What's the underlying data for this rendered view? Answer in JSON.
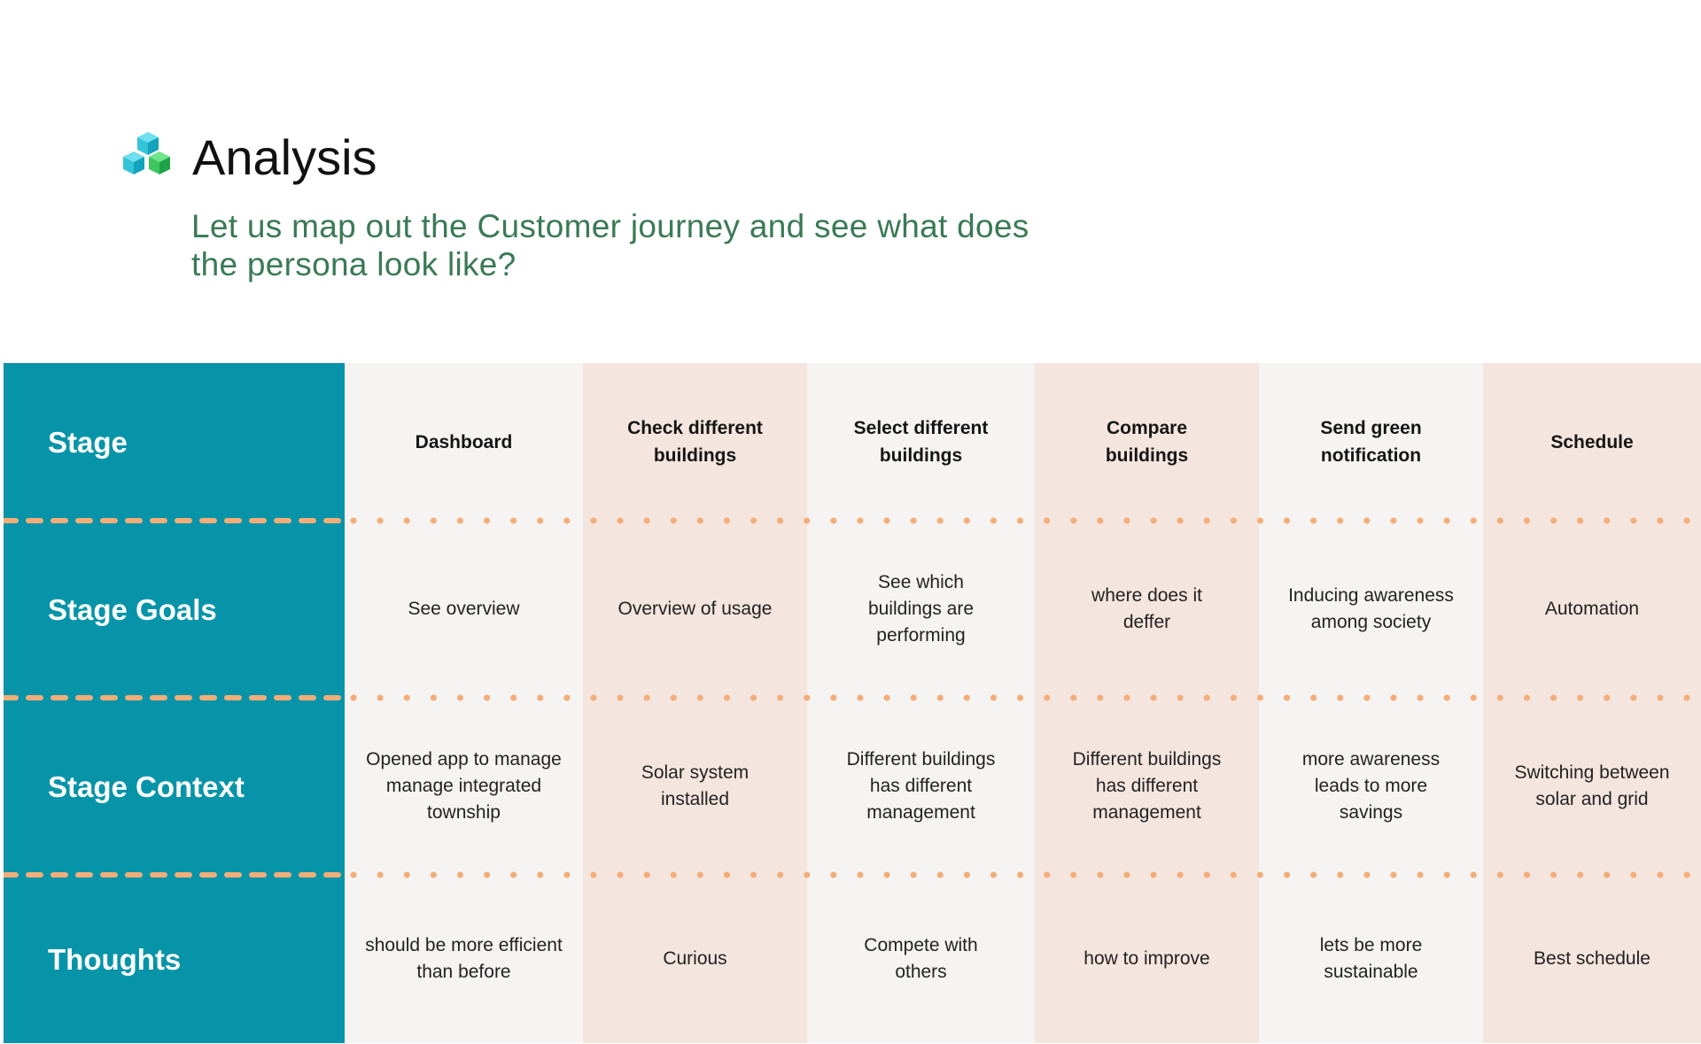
{
  "header": {
    "title": "Analysis",
    "subtitle": "Let us map out the Customer journey and see what does the persona look like?",
    "logo_icon": "stacked-cubes-icon"
  },
  "journey_map": {
    "row_labels": [
      "Stage",
      "Stage Goals",
      "Stage Context",
      "Thoughts"
    ],
    "stages": [
      {
        "stage": "Dashboard",
        "goal": "See overview",
        "context": "Opened app to manage manage integrated township",
        "thought": "should be more efficient than before"
      },
      {
        "stage": "Check different buildings",
        "goal": "Overview of usage",
        "context": "Solar system installed",
        "thought": "Curious"
      },
      {
        "stage": "Select different buildings",
        "goal": "See which buildings are performing",
        "context": "Different buildings has different management",
        "thought": "Compete with others"
      },
      {
        "stage": "Compare buildings",
        "goal": "where does it deffer",
        "context": "Different buildings has different management",
        "thought": "how to improve"
      },
      {
        "stage": "Send green notification",
        "goal": "Inducing awareness among society",
        "context": "more awareness leads to more savings",
        "thought": "lets be more sustainable"
      },
      {
        "stage": "Schedule",
        "goal": "Automation",
        "context": "Switching between solar and grid",
        "thought": "Best schedule"
      }
    ]
  },
  "colors": {
    "label_column": "#0794a8",
    "column_light": "#f5f4f3",
    "column_peach": "#f4e5de",
    "divider": "#f4ad78",
    "subtitle": "#3a7a55"
  }
}
